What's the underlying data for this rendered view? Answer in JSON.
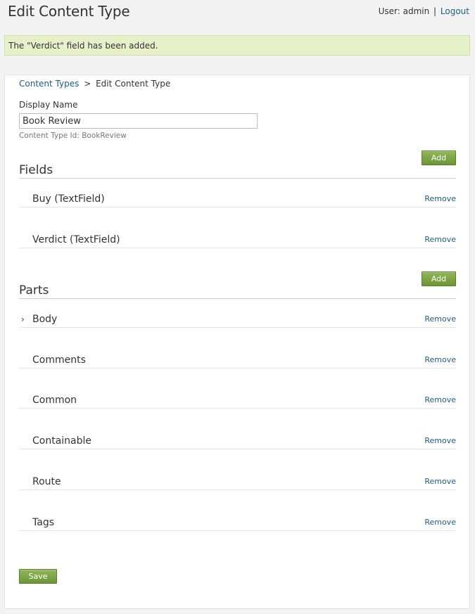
{
  "header": {
    "title": "Edit Content Type",
    "user_label": "User: admin",
    "separator": "|",
    "logout": "Logout"
  },
  "message": "The \"Verdict\" field has been added.",
  "breadcrumb": {
    "link": "Content Types",
    "separator": ">",
    "current": "Edit Content Type"
  },
  "form": {
    "display_name_label": "Display Name",
    "display_name_value": "Book Review",
    "content_type_id": "Content Type Id: BookReview"
  },
  "fields_section": {
    "title": "Fields",
    "add_label": "Add",
    "items": [
      {
        "name": "Buy (TextField)",
        "action": "Remove"
      },
      {
        "name": "Verdict (TextField)",
        "action": "Remove"
      }
    ]
  },
  "parts_section": {
    "title": "Parts",
    "add_label": "Add",
    "expander": "›",
    "items": [
      {
        "name": "Body",
        "action": "Remove"
      },
      {
        "name": "Comments",
        "action": "Remove"
      },
      {
        "name": "Common",
        "action": "Remove"
      },
      {
        "name": "Containable",
        "action": "Remove"
      },
      {
        "name": "Route",
        "action": "Remove"
      },
      {
        "name": "Tags",
        "action": "Remove"
      }
    ]
  },
  "save_label": "Save"
}
